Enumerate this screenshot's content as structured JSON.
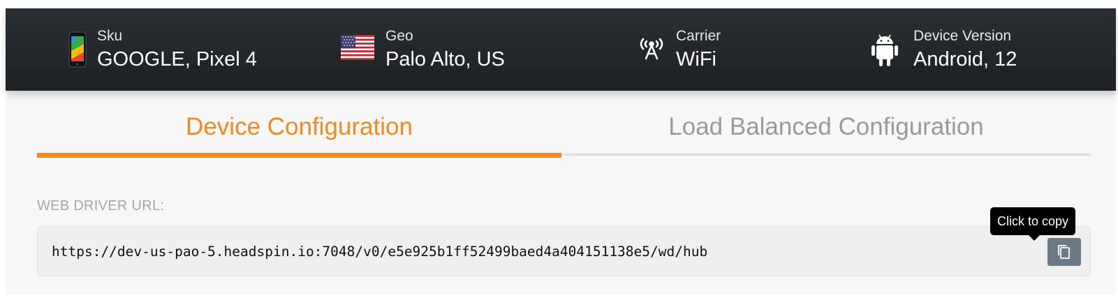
{
  "header": {
    "items": [
      {
        "label": "Sku",
        "value": "GOOGLE, Pixel 4",
        "icon": "phone-icon"
      },
      {
        "label": "Geo",
        "value": "Palo Alto, US",
        "icon": "us-flag-icon"
      },
      {
        "label": "Carrier",
        "value": "WiFi",
        "icon": "antenna-icon"
      },
      {
        "label": "Device Version",
        "value": "Android, 12",
        "icon": "android-icon"
      }
    ]
  },
  "tabs": [
    {
      "label": "Device Configuration",
      "active": true
    },
    {
      "label": "Load Balanced Configuration",
      "active": false
    }
  ],
  "webdriver": {
    "label": "WEB DRIVER URL:",
    "url": "https://dev-us-pao-5.headspin.io:7048/v0/e5e925b1ff52499baed4a404151138e5/wd/hub",
    "copy_tooltip": "Click to copy"
  },
  "colors": {
    "accent": "#f5871f",
    "header_bg": "#23282c",
    "copy_button": "#6b7a86"
  }
}
